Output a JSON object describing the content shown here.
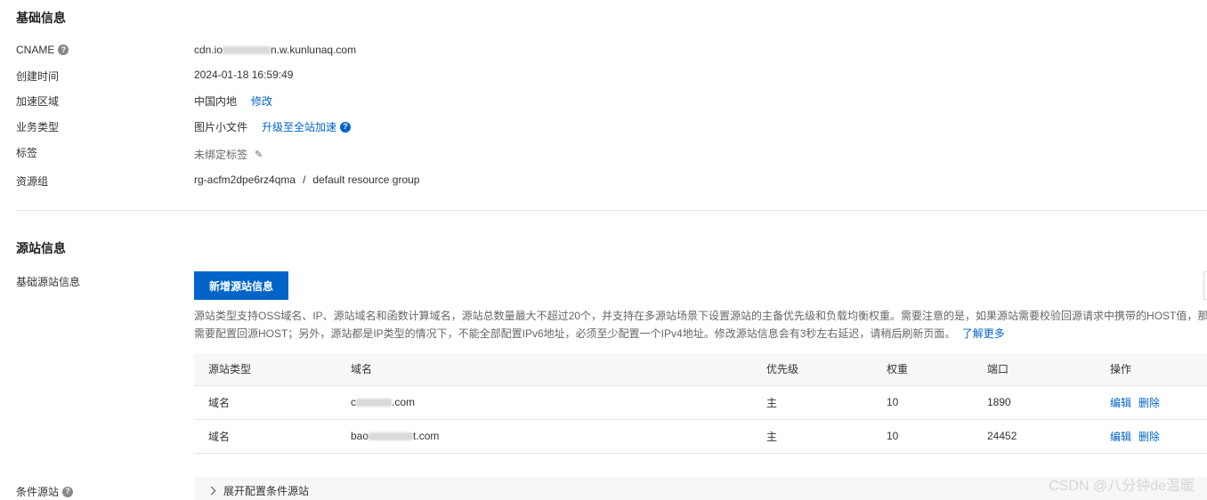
{
  "basic": {
    "title": "基础信息",
    "cname_label": "CNAME",
    "cname_value_prefix": "cdn.io",
    "cname_value_suffix": "n.w.kunlunaq.com",
    "created_label": "创建时间",
    "created_value": "2024-01-18 16:59:49",
    "region_label": "加速区域",
    "region_value": "中国内地",
    "region_action": "修改",
    "biz_label": "业务类型",
    "biz_value": "图片小文件",
    "biz_action": "升级至全站加速",
    "tag_label": "标签",
    "tag_value": "未绑定标签",
    "rg_label": "资源组",
    "rg_value": "rg-acfm2dpe6rz4qma",
    "rg_sep": "/",
    "rg_name": "default resource group"
  },
  "origin": {
    "title": "源站信息",
    "basic_label": "基础源站信息",
    "add_button": "新增源站信息",
    "desc_line1": "源站类型支持OSS域名、IP、源站域名和函数计算域名，源站总数量最大不超过20个，并支持在多源站场景下设置源站的主备优先级和负载均衡权重。需要注意的是，如果源站需要校验回源请求中携带的HOST值，那",
    "desc_line2": "需要配置回源HOST；另外，源站都是IP类型的情况下，不能全部配置IPv6地址，必须至少配置一个IPv4地址。修改源站信息会有3秒左右延迟，请稍后刷新页面。",
    "learn_more": "了解更多",
    "columns": [
      "源站类型",
      "域名",
      "优先级",
      "权重",
      "端口",
      "操作"
    ],
    "rows": [
      {
        "type": "域名",
        "domain_prefix": "c",
        "domain_suffix": ".com",
        "priority": "主",
        "weight": "10",
        "port": "1890",
        "edit": "编辑",
        "delete": "删除"
      },
      {
        "type": "域名",
        "domain_prefix": "bao",
        "domain_suffix": "t.com",
        "priority": "主",
        "weight": "10",
        "port": "24452",
        "edit": "编辑",
        "delete": "删除"
      }
    ],
    "cond_label": "条件源站",
    "cond_expand": "展开配置条件源站"
  },
  "watermark": "CSDN @八分钟de温暖",
  "colors": {
    "primary": "#0064c8",
    "table_header_bg": "#f7f7f7",
    "divider": "#e5e5e5"
  }
}
